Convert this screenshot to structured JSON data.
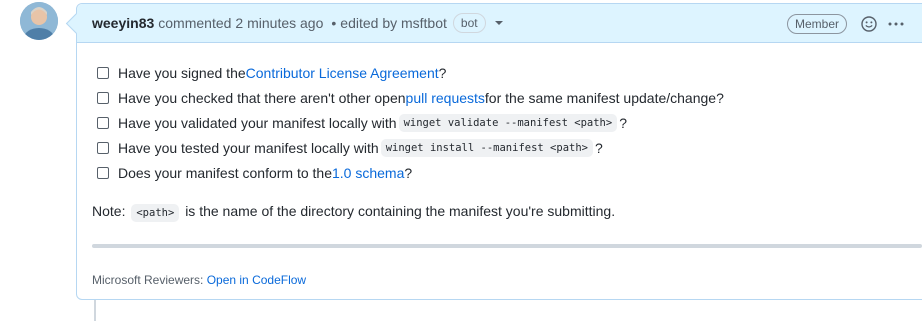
{
  "header": {
    "author": "weeyin83",
    "action": "commented",
    "time": "2 minutes ago",
    "separator": "•",
    "edited_by": "edited by msftbot",
    "bot_badge": "bot",
    "member_badge": "Member"
  },
  "checklist": [
    {
      "before": "Have you signed the ",
      "link": "Contributor License Agreement",
      "after": "?"
    },
    {
      "before": "Have you checked that there aren't other open ",
      "link": "pull requests",
      "after": " for the same manifest update/change?"
    },
    {
      "before": "Have you validated your manifest locally with ",
      "code": "winget validate --manifest <path>",
      "after": "?"
    },
    {
      "before": "Have you tested your manifest locally with ",
      "code": "winget install --manifest <path>",
      "after": "?"
    },
    {
      "before": "Does your manifest conform to the ",
      "link": "1.0 schema",
      "after": "?"
    }
  ],
  "note": {
    "prefix": "Note: ",
    "code": "<path>",
    "suffix": " is the name of the directory containing the manifest you're submitting."
  },
  "footer": {
    "label": "Microsoft Reviewers: ",
    "link": "Open in CodeFlow"
  },
  "colors": {
    "link": "#0969da",
    "header_bg": "#ddf4ff",
    "border": "#b6d7f2"
  }
}
